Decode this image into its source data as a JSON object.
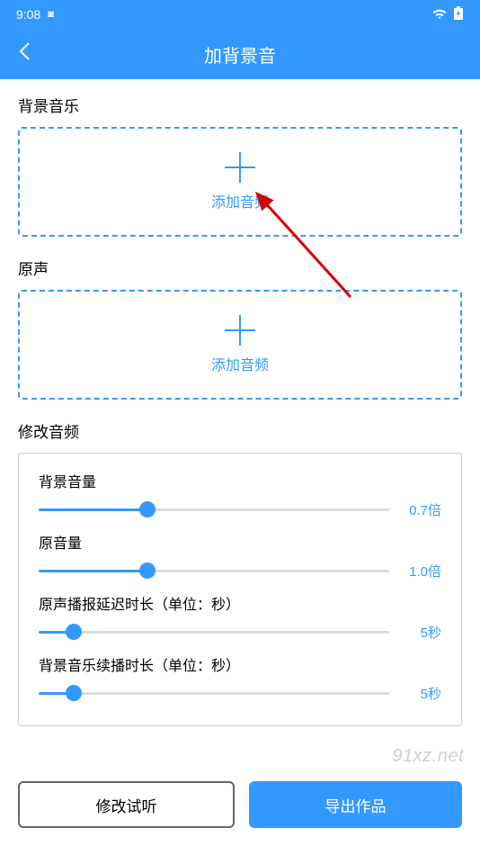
{
  "statusbar": {
    "time": "9:08"
  },
  "header": {
    "title": "加背景音"
  },
  "sections": {
    "bgm_label": "背景音乐",
    "bgm_add_text": "添加音频",
    "original_label": "原声",
    "original_add_text": "添加音频",
    "modify_label": "修改音频"
  },
  "sliders": {
    "bg_volume": {
      "label": "背景音量",
      "value_text": "0.7倍",
      "percent": 31
    },
    "orig_volume": {
      "label": "原音量",
      "value_text": "1.0倍",
      "percent": 31
    },
    "delay": {
      "label": "原声播报延迟时长（单位：秒）",
      "value_text": "5秒",
      "percent": 10
    },
    "continue": {
      "label": "背景音乐续播时长（单位：秒）",
      "value_text": "5秒",
      "percent": 10
    }
  },
  "buttons": {
    "preview": "修改试听",
    "export": "导出作品"
  },
  "watermark": "91xz.net"
}
